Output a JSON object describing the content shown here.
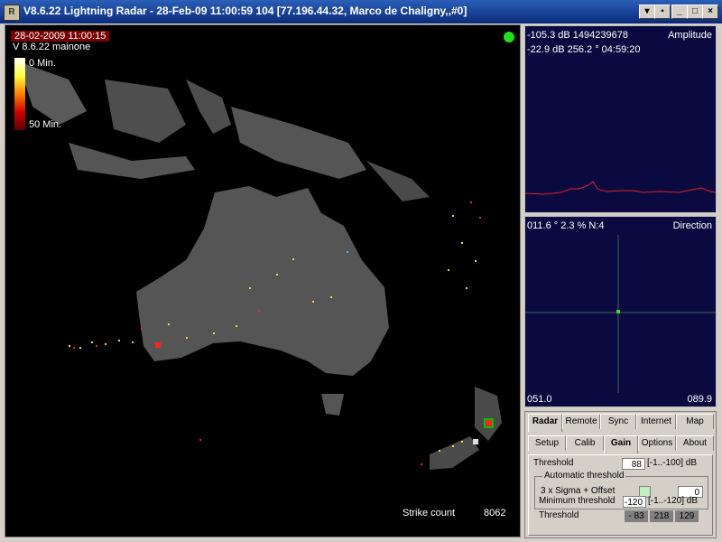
{
  "window": {
    "title": "V8.6.22 Lightning Radar - 28-Feb-09 11:00:59 104   [77.196.44.32, Marco de Chaligny,,#0]",
    "app_icon": "radar-app-icon"
  },
  "map": {
    "timestamp": "28-02-2009 11:00:15",
    "version": "V 8.6.22 mainone",
    "legend_top": "0 Min.",
    "legend_bottom": "50 Min.",
    "strike_count_label": "Strike count",
    "strike_count_value": "8062",
    "status_color": "#20e020"
  },
  "amplitude": {
    "line1": "-105.3 dB  1494239678",
    "line2": "-22.9 dB   256.2 °   04:59:20",
    "label": "Amplitude",
    "trace_color": "#e02020"
  },
  "direction": {
    "line1": "011.6 °  2.3 %  N:4",
    "label": "Direction",
    "bottom_left": "051.0",
    "bottom_right": "089.9"
  },
  "tabs": {
    "row1": [
      "Radar",
      "Remote",
      "Sync",
      "Internet",
      "Map"
    ],
    "row2": [
      "Setup",
      "Calib",
      "Gain",
      "Options",
      "About"
    ],
    "active_row1": "Radar",
    "active_row2": "Gain"
  },
  "gain": {
    "threshold_label": "Threshold",
    "threshold_value": "88",
    "threshold_range": "[-1..-100] dB",
    "auto_group_title": "Automatic threshold",
    "sigma_label": "3 x Sigma + Offset",
    "sigma_value": "0",
    "min_threshold_label": "Minimum threshold",
    "min_threshold_value": "-120",
    "min_threshold_range": "[-1..-120] dB",
    "threshold2_label": "Threshold",
    "threshold2_values": [
      "- 83",
      "218",
      "129"
    ]
  }
}
